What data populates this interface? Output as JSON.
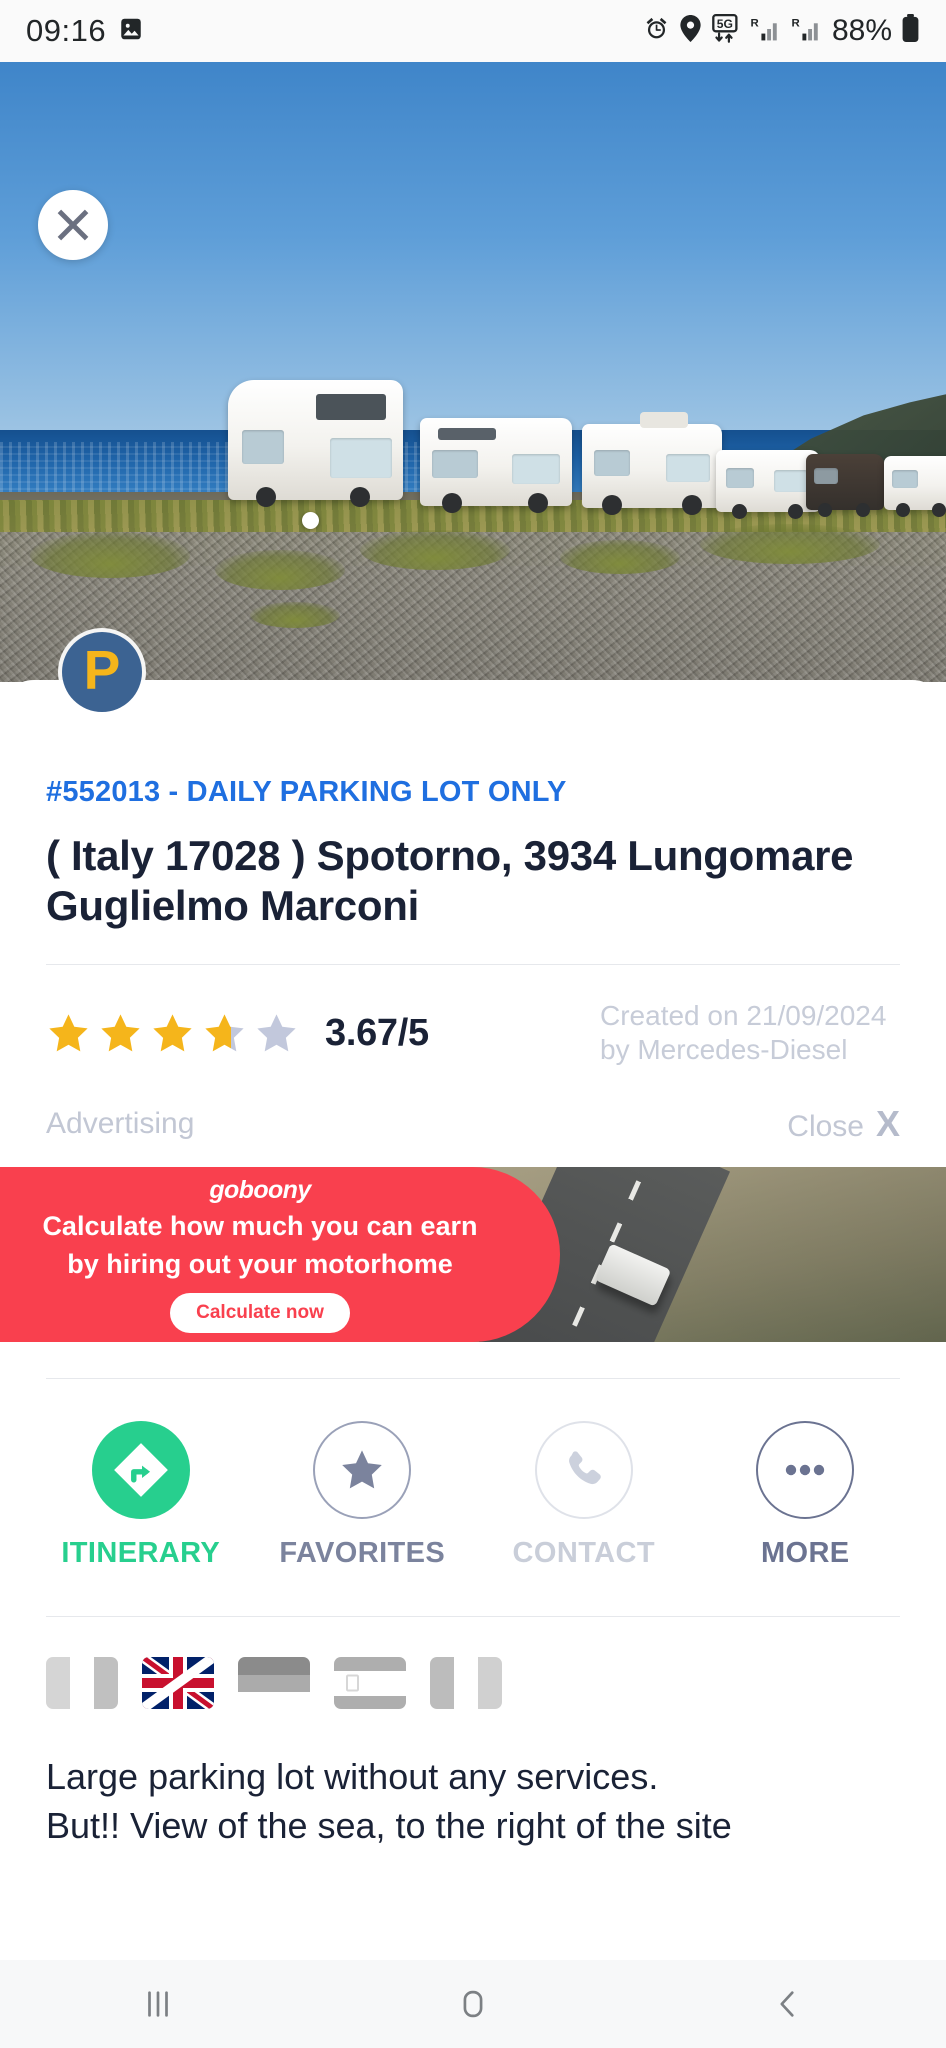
{
  "status_bar": {
    "time": "09:16",
    "battery_text": "88%",
    "icons": [
      "image-icon",
      "alarm-icon",
      "location-pin-icon",
      "5g-icon",
      "signal-roaming-1-icon",
      "signal-roaming-2-icon",
      "battery-icon"
    ],
    "network_label": "5G",
    "roaming_label": "R"
  },
  "hero": {
    "close_label": "×",
    "alt": "Row of white motorhomes parked on a gravel lot beside the sea"
  },
  "listing": {
    "badge_letter": "P",
    "reference": "#552013 - DAILY PARKING LOT ONLY",
    "title": "( Italy 17028 ) Spotorno, 3934 Lungomare Guglielmo Marconi",
    "rating_value": "3.67/5",
    "rating_number": 3.67,
    "rating_max": 5,
    "created_text": "Created on 21/09/2024 by Mercedes-Diesel"
  },
  "advertising": {
    "label": "Advertising",
    "close_label": "Close",
    "close_mark": "X",
    "brand": "goboony",
    "headline_line1": "Calculate how much you can earn",
    "headline_line2": "by hiring out your motorhome",
    "cta": "Calculate now"
  },
  "actions": [
    {
      "label": "ITINERARY",
      "icon": "directions-turn-right-icon",
      "state": "active"
    },
    {
      "label": "FAVORITES",
      "icon": "star-icon",
      "state": "default"
    },
    {
      "label": "CONTACT",
      "icon": "phone-icon",
      "state": "disabled"
    },
    {
      "label": "MORE",
      "icon": "ellipsis-icon",
      "state": "default"
    }
  ],
  "languages": [
    {
      "name": "italy-flag",
      "selected": false
    },
    {
      "name": "united-kingdom-flag",
      "selected": true
    },
    {
      "name": "germany-flag",
      "selected": false
    },
    {
      "name": "spain-flag",
      "selected": false
    },
    {
      "name": "france-flag",
      "selected": false
    }
  ],
  "description": {
    "line1": "Large parking lot without any services.",
    "line2": "But!! View of the sea, to the right of the site"
  },
  "navbar": [
    {
      "name": "recents-button",
      "icon": "recents-icon"
    },
    {
      "name": "home-button",
      "icon": "home-icon"
    },
    {
      "name": "back-button",
      "icon": "back-chevron-icon"
    }
  ],
  "colors": {
    "accent_blue": "#1f6fe0",
    "title_navy": "#1a2236",
    "star_gold": "#f5b51b",
    "star_empty": "#c2c8dc",
    "green": "#27cf8e",
    "ad_red": "#f9404e",
    "badge_blue": "#3c6392",
    "badge_letter": "#f5b51b"
  }
}
